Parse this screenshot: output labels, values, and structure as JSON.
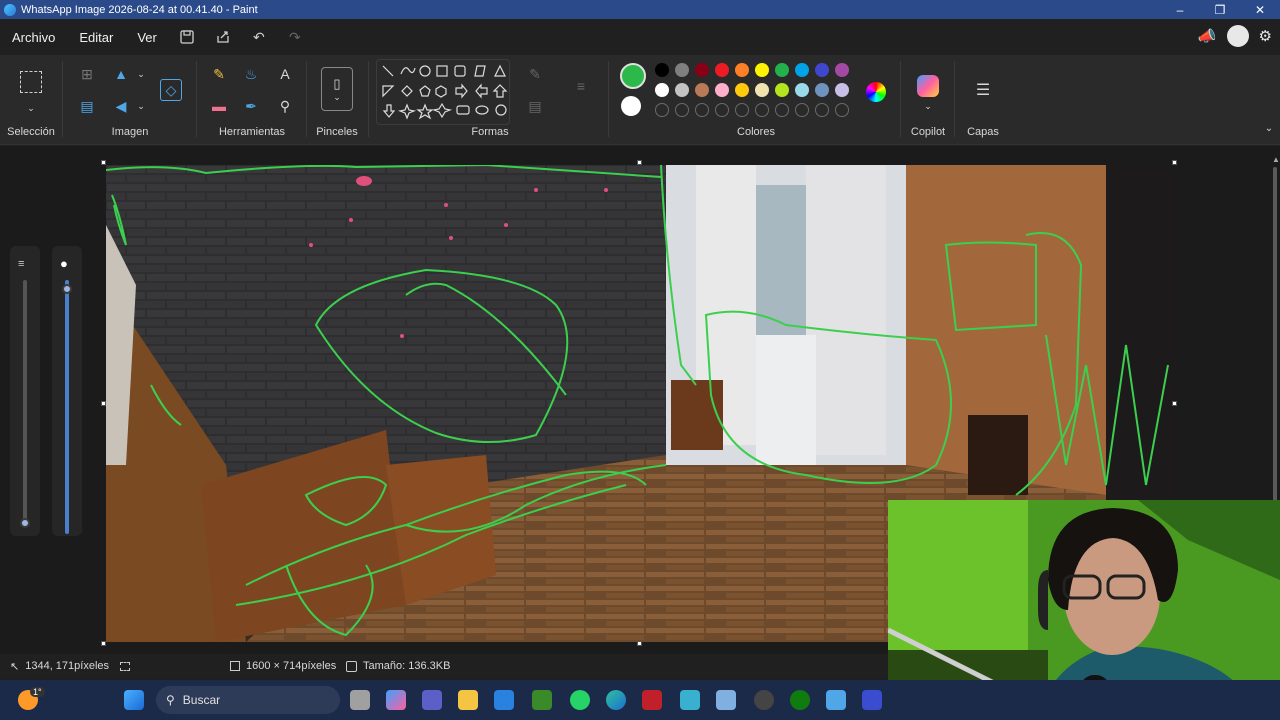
{
  "window": {
    "title": "WhatsApp Image 2026-08-24 at 00.41.40 - Paint"
  },
  "menu": {
    "items": [
      "Archivo",
      "Editar",
      "Ver"
    ]
  },
  "ribbon": {
    "groups": {
      "seleccion": "Selección",
      "imagen": "Imagen",
      "herramientas": "Herramientas",
      "pinceles": "Pinceles",
      "formas": "Formas",
      "colores": "Colores",
      "copilot": "Copilot",
      "capas": "Capas"
    },
    "colors": {
      "primary": "#2db84a",
      "secondary": "#ffffff",
      "row1": [
        "#000000",
        "#7f7f7f",
        "#880015",
        "#ed1c24",
        "#ff7f27",
        "#fff200",
        "#22b14c",
        "#00a2e8",
        "#3f48cc",
        "#a349a4"
      ],
      "row2": [
        "#ffffff",
        "#c3c3c3",
        "#b97a57",
        "#ffaec9",
        "#ffc90e",
        "#efe4b0",
        "#b5e61d",
        "#99d9ea",
        "#7092be",
        "#c8bfe7"
      ]
    }
  },
  "status": {
    "cursor": "1344, 171píxeles",
    "dimensions": "1600 × 714píxeles",
    "size": "Tamaño: 136.3KB"
  },
  "taskbar": {
    "search_placeholder": "Buscar",
    "weather": "1°"
  }
}
